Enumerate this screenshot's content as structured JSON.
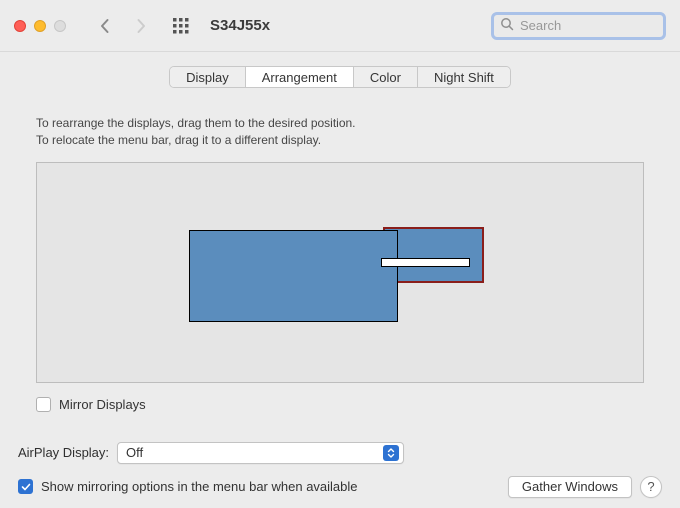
{
  "header": {
    "title": "S34J55x",
    "search_placeholder": "Search"
  },
  "tabs": {
    "display": "Display",
    "arrangement": "Arrangement",
    "color": "Color",
    "night_shift": "Night Shift"
  },
  "instructions": {
    "line1": "To rearrange the displays, drag them to the desired position.",
    "line2": "To relocate the menu bar, drag it to a different display."
  },
  "mirror": {
    "label": "Mirror Displays",
    "checked": false
  },
  "airplay": {
    "label": "AirPlay Display:",
    "value": "Off"
  },
  "show_mirroring": {
    "label": "Show mirroring options in the menu bar when available",
    "checked": true
  },
  "gather": "Gather Windows",
  "help": "?"
}
